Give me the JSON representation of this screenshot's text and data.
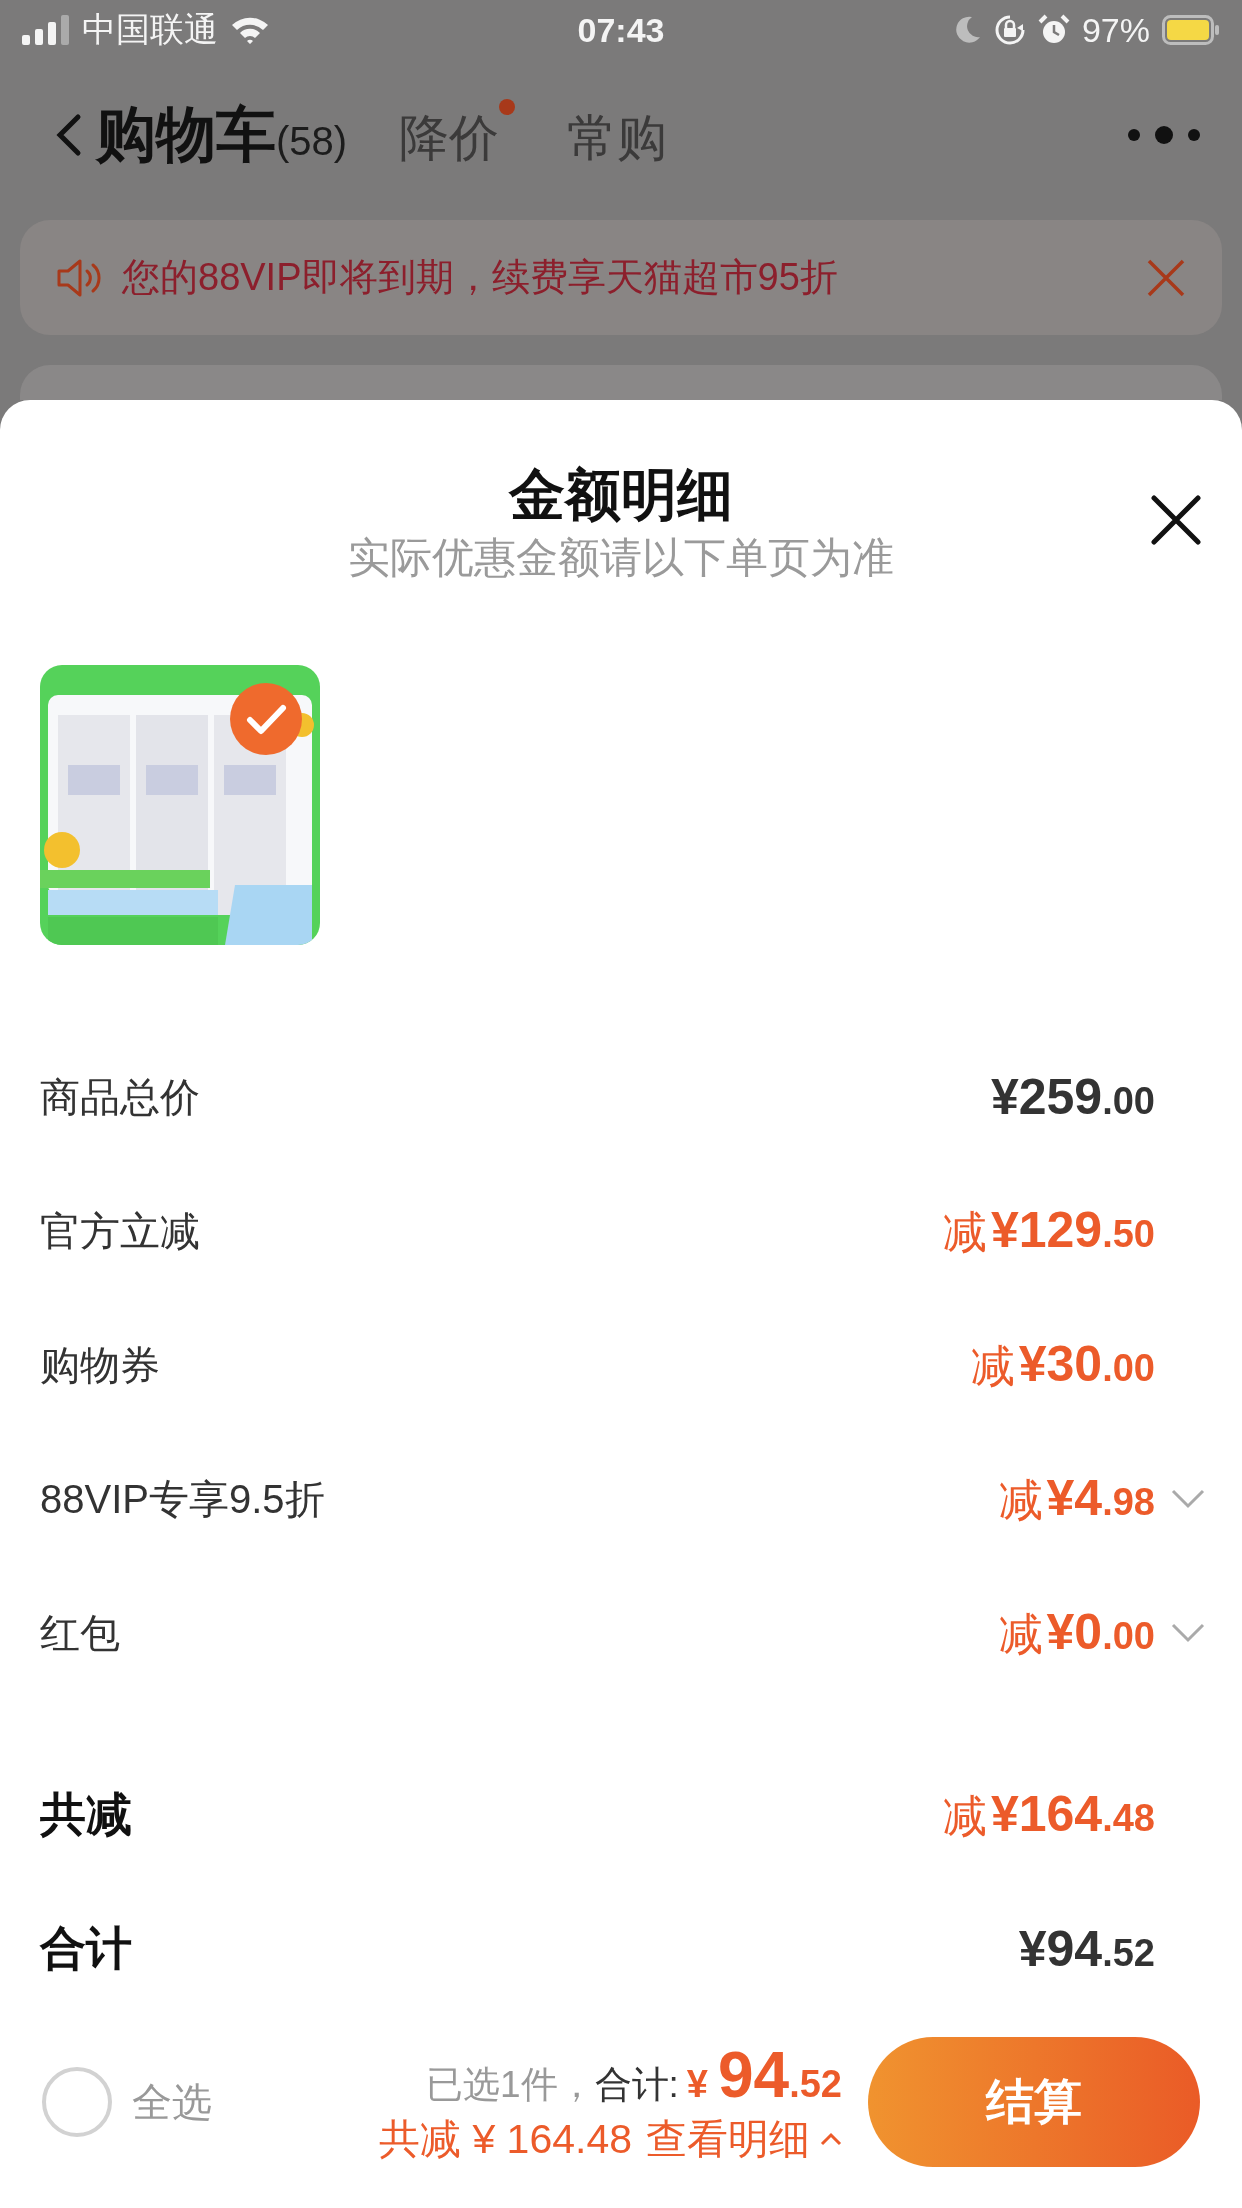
{
  "status_bar": {
    "carrier": "中国联通",
    "time": "07:43",
    "battery": "97%"
  },
  "header": {
    "tabs": [
      {
        "label": "购物车",
        "count": "(58)",
        "selected": true,
        "dot": false
      },
      {
        "label": "降价",
        "selected": false,
        "dot": true
      },
      {
        "label": "常购",
        "selected": false,
        "dot": false
      }
    ]
  },
  "notice": {
    "text": "您的88VIP即将到期，续费享天猫超市95折"
  },
  "sheet": {
    "title": "金额明细",
    "subtitle": "实际优惠金额请以下单页为准",
    "product": {
      "kind": "picture",
      "selected": true
    },
    "rows": [
      {
        "kind": "detail",
        "label": "商品总价",
        "discount": false,
        "amount": "¥259",
        "cents": ".00",
        "expandable": false
      },
      {
        "kind": "detail",
        "label": "官方立减",
        "discount": true,
        "prefix": "减",
        "amount": "¥129",
        "cents": ".50",
        "expandable": false
      },
      {
        "kind": "detail",
        "label": "购物券",
        "discount": true,
        "prefix": "减",
        "amount": "¥30",
        "cents": ".00",
        "expandable": false
      },
      {
        "kind": "detail",
        "label": "88VIP专享9.5折",
        "discount": true,
        "prefix": "减",
        "amount": "¥4",
        "cents": ".98",
        "expandable": true
      },
      {
        "kind": "detail",
        "label": "红包",
        "discount": true,
        "prefix": "减",
        "amount": "¥0",
        "cents": ".00",
        "expandable": true
      },
      {
        "kind": "summary",
        "label": "共减",
        "discount": true,
        "prefix": "减",
        "amount": "¥164",
        "cents": ".48",
        "expandable": false
      },
      {
        "kind": "summary",
        "label": "合计",
        "discount": false,
        "amount": "¥94",
        "cents": ".52",
        "expandable": false
      }
    ]
  },
  "bottom_bar": {
    "select_all": {
      "label": "全选",
      "checked": false
    },
    "selected_count": "已选1件，",
    "total_label": "合计:",
    "currency": "¥",
    "amount": "94",
    "cents": ".52",
    "saved": "共减 ¥ 164.48",
    "detail_link": "查看明细",
    "checkout": "结算"
  }
}
